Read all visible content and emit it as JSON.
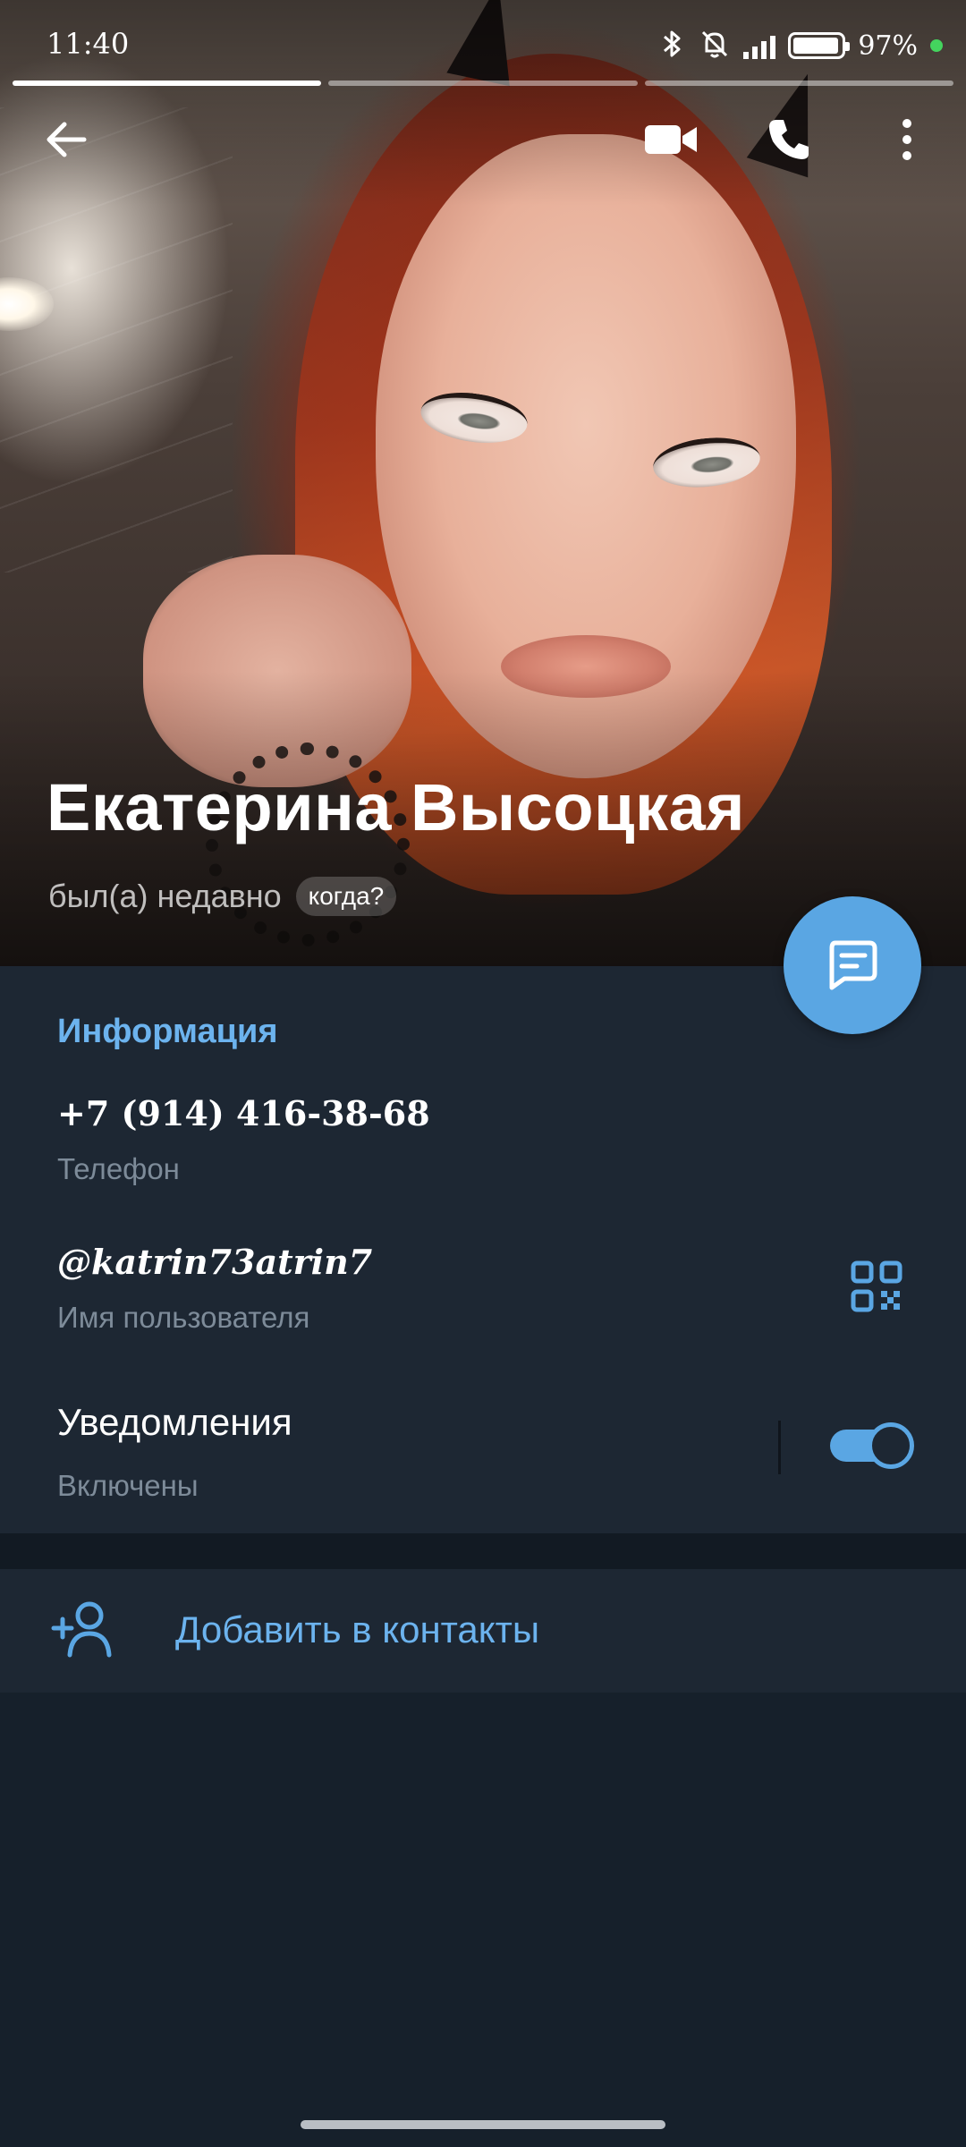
{
  "status_bar": {
    "time": "11:40",
    "battery_text": "97%",
    "battery_level": 0.97,
    "icons": [
      "bluetooth-icon",
      "mute-bell-icon",
      "signal-icon",
      "battery-icon",
      "charging-dot-icon"
    ]
  },
  "story_progress": {
    "segments": 3,
    "active_index": 0
  },
  "top_actions": [
    "back-arrow-icon",
    "video-call-icon",
    "phone-call-icon",
    "more-vertical-icon"
  ],
  "profile": {
    "name": "Екатерина Высоцкая",
    "last_seen": "был(а) недавно",
    "last_seen_chip": "когда?"
  },
  "info": {
    "section_title": "Информация",
    "phone": {
      "value": "+7 (914) 416-38-68",
      "label": "Телефон"
    },
    "username": {
      "value": "@katrin73atrin7",
      "label": "Имя пользователя"
    },
    "notifications": {
      "value": "Уведомления",
      "label": "Включены",
      "enabled": true
    }
  },
  "actions": {
    "add_contact": "Добавить в контакты"
  },
  "colors": {
    "accent": "#5aa6e3",
    "accent_text": "#6cb3ee",
    "card_bg": "#1d2733",
    "page_bg": "#16202b"
  }
}
